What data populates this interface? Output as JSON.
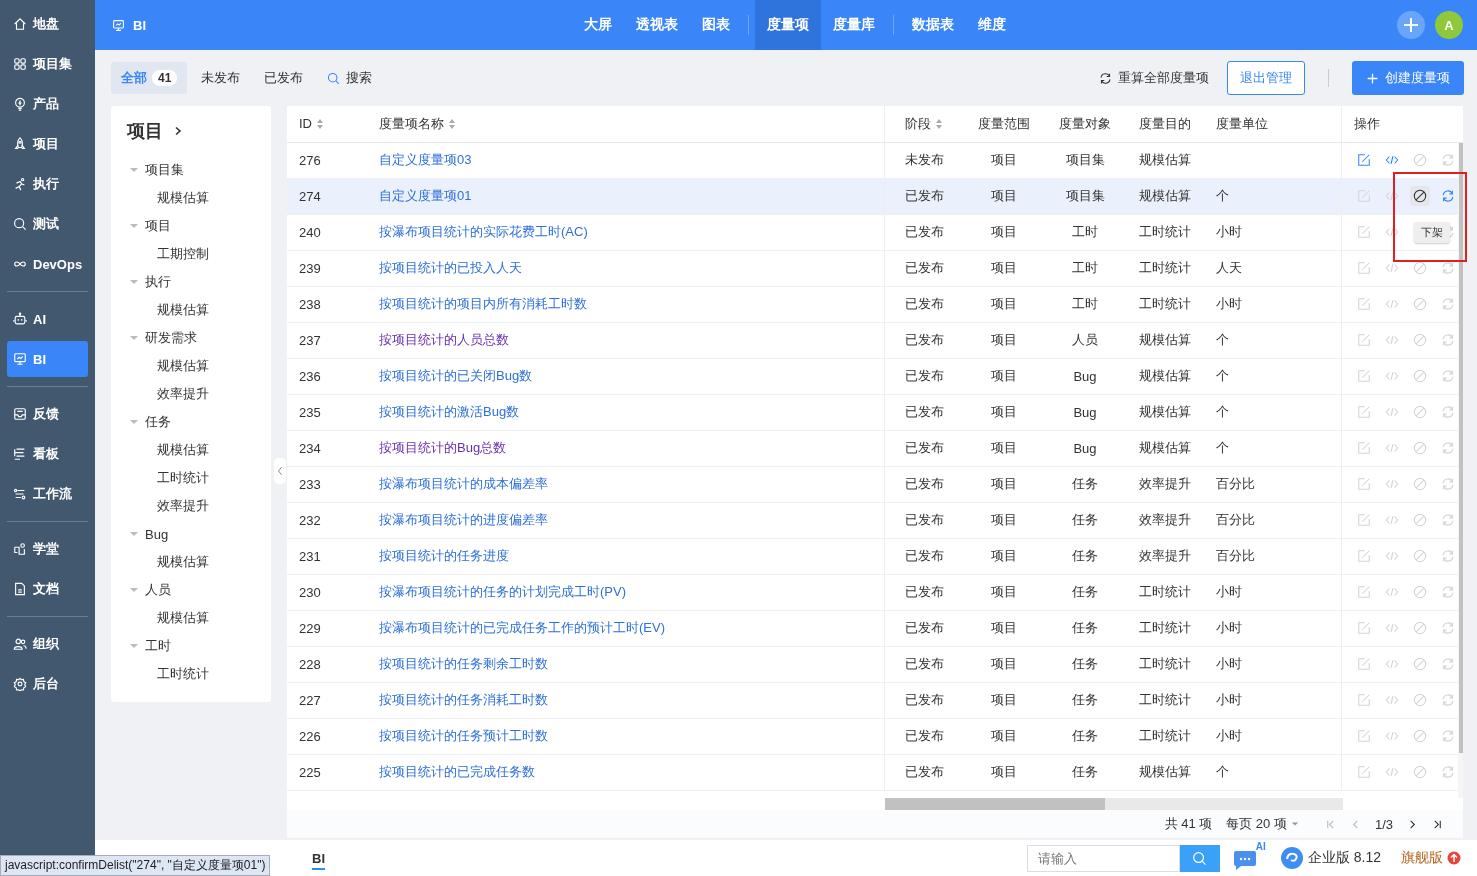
{
  "sidebar": {
    "groups": [
      [
        {
          "label": "地盘",
          "selected": false
        },
        {
          "label": "项目集",
          "selected": false
        },
        {
          "label": "产品",
          "selected": false
        },
        {
          "label": "项目",
          "selected": false
        },
        {
          "label": "执行",
          "selected": false
        },
        {
          "label": "测试",
          "selected": false
        },
        {
          "label": "DevOps",
          "selected": false
        }
      ],
      [
        {
          "label": "AI",
          "selected": false
        },
        {
          "label": "BI",
          "selected": true
        }
      ],
      [
        {
          "label": "反馈",
          "selected": false
        },
        {
          "label": "看板",
          "selected": false
        },
        {
          "label": "工作流",
          "selected": false
        }
      ],
      [
        {
          "label": "学堂",
          "selected": false
        },
        {
          "label": "文档",
          "selected": false
        }
      ],
      [
        {
          "label": "组织",
          "selected": false
        },
        {
          "label": "后台",
          "selected": false
        }
      ]
    ]
  },
  "header": {
    "module": "BI",
    "nav_groups": [
      [
        {
          "label": "大屏",
          "selected": false
        },
        {
          "label": "透视表",
          "selected": false
        },
        {
          "label": "图表",
          "selected": false
        }
      ],
      [
        {
          "label": "度量项",
          "selected": true
        },
        {
          "label": "度量库",
          "selected": false
        }
      ],
      [
        {
          "label": "数据表",
          "selected": false
        },
        {
          "label": "维度",
          "selected": false
        }
      ]
    ],
    "avatar": "A"
  },
  "filter_tabs": [
    {
      "label": "全部",
      "count": "41",
      "selected": true
    },
    {
      "label": "未发布",
      "selected": false
    },
    {
      "label": "已发布",
      "selected": false
    }
  ],
  "search_label": "搜索",
  "recalc_label": "重算全部度量项",
  "exit_button": "退出管理",
  "create_button": "创建度量项",
  "tree": {
    "title": "项目",
    "items": [
      {
        "label": "项目集",
        "expanded": true,
        "children": [
          {
            "label": "规模估算"
          }
        ]
      },
      {
        "label": "项目",
        "expanded": true,
        "children": [
          {
            "label": "工期控制"
          }
        ]
      },
      {
        "label": "执行",
        "expanded": true,
        "children": [
          {
            "label": "规模估算"
          }
        ]
      },
      {
        "label": "研发需求",
        "expanded": true,
        "children": [
          {
            "label": "规模估算"
          },
          {
            "label": "效率提升"
          }
        ]
      },
      {
        "label": "任务",
        "expanded": true,
        "children": [
          {
            "label": "规模估算"
          },
          {
            "label": "工时统计"
          },
          {
            "label": "效率提升"
          }
        ]
      },
      {
        "label": "Bug",
        "expanded": true,
        "children": [
          {
            "label": "规模估算"
          }
        ]
      },
      {
        "label": "人员",
        "expanded": true,
        "children": [
          {
            "label": "规模估算"
          }
        ]
      },
      {
        "label": "工时",
        "expanded": true,
        "children": [
          {
            "label": "工时统计"
          }
        ]
      }
    ]
  },
  "table": {
    "columns": [
      {
        "label": "ID",
        "sortable": true
      },
      {
        "label": "度量项名称",
        "sortable": true
      },
      {
        "label": "阶段",
        "sortable": true
      },
      {
        "label": "度量范围",
        "sortable": false
      },
      {
        "label": "度量对象",
        "sortable": false
      },
      {
        "label": "度量目的",
        "sortable": false
      },
      {
        "label": "度量单位",
        "sortable": false
      },
      {
        "label": "操作",
        "sortable": false
      }
    ],
    "rows": [
      {
        "id": "276",
        "name": "自定义度量项03",
        "visited": false,
        "stage": "未发布",
        "scope": "项目",
        "object": "项目集",
        "purpose": "规模估算",
        "hovered": false,
        "actions": [
          {
            "enabled": true,
            "hovered": false
          },
          {
            "enabled": true,
            "hovered": false
          },
          {
            "enabled": false,
            "hovered": false
          },
          {
            "enabled": false,
            "hovered": false
          }
        ]
      },
      {
        "id": "274",
        "name": "自定义度量项01",
        "visited": false,
        "stage": "已发布",
        "scope": "项目",
        "object": "项目集",
        "purpose": "规模估算",
        "unit": "个",
        "hovered": true,
        "actions": [
          {
            "enabled": false,
            "hovered": false
          },
          {
            "enabled": false,
            "hovered": false
          },
          {
            "enabled": true,
            "hovered": true
          },
          {
            "enabled": true,
            "hovered": false
          }
        ]
      },
      {
        "id": "240",
        "name": "按瀑布项目统计的实际花费工时(AC)",
        "visited": false,
        "stage": "已发布",
        "scope": "项目",
        "object": "工时",
        "purpose": "工时统计",
        "unit": "小时",
        "hovered": false,
        "actions": [
          {
            "enabled": false,
            "hovered": false
          },
          {
            "enabled": false,
            "hovered": false
          },
          {
            "enabled": false,
            "hovered": false
          },
          {
            "enabled": false,
            "hovered": false
          }
        ]
      },
      {
        "id": "239",
        "name": "按项目统计的已投入人天",
        "visited": false,
        "stage": "已发布",
        "scope": "项目",
        "object": "工时",
        "purpose": "工时统计",
        "unit": "人天",
        "hovered": false,
        "actions": [
          {
            "enabled": false,
            "hovered": false
          },
          {
            "enabled": false,
            "hovered": false
          },
          {
            "enabled": false,
            "hovered": false
          },
          {
            "enabled": false,
            "hovered": false
          }
        ]
      },
      {
        "id": "238",
        "name": "按项目统计的项目内所有消耗工时数",
        "visited": false,
        "stage": "已发布",
        "scope": "项目",
        "object": "工时",
        "purpose": "工时统计",
        "unit": "小时",
        "hovered": false,
        "actions": [
          {
            "enabled": false,
            "hovered": false
          },
          {
            "enabled": false,
            "hovered": false
          },
          {
            "enabled": false,
            "hovered": false
          },
          {
            "enabled": false,
            "hovered": false
          }
        ]
      },
      {
        "id": "237",
        "name": "按项目统计的人员总数",
        "visited": true,
        "stage": "已发布",
        "scope": "项目",
        "object": "人员",
        "purpose": "规模估算",
        "unit": "个",
        "hovered": false,
        "actions": [
          {
            "enabled": false,
            "hovered": false
          },
          {
            "enabled": false,
            "hovered": false
          },
          {
            "enabled": false,
            "hovered": false
          },
          {
            "enabled": false,
            "hovered": false
          }
        ]
      },
      {
        "id": "236",
        "name": "按项目统计的已关闭Bug数",
        "visited": false,
        "stage": "已发布",
        "scope": "项目",
        "object": "Bug",
        "purpose": "规模估算",
        "unit": "个",
        "hovered": false,
        "actions": [
          {
            "enabled": false,
            "hovered": false
          },
          {
            "enabled": false,
            "hovered": false
          },
          {
            "enabled": false,
            "hovered": false
          },
          {
            "enabled": false,
            "hovered": false
          }
        ]
      },
      {
        "id": "235",
        "name": "按项目统计的激活Bug数",
        "visited": false,
        "stage": "已发布",
        "scope": "项目",
        "object": "Bug",
        "purpose": "规模估算",
        "unit": "个",
        "hovered": false,
        "actions": [
          {
            "enabled": false,
            "hovered": false
          },
          {
            "enabled": false,
            "hovered": false
          },
          {
            "enabled": false,
            "hovered": false
          },
          {
            "enabled": false,
            "hovered": false
          }
        ]
      },
      {
        "id": "234",
        "name": "按项目统计的Bug总数",
        "visited": true,
        "stage": "已发布",
        "scope": "项目",
        "object": "Bug",
        "purpose": "规模估算",
        "unit": "个",
        "hovered": false,
        "actions": [
          {
            "enabled": false,
            "hovered": false
          },
          {
            "enabled": false,
            "hovered": false
          },
          {
            "enabled": false,
            "hovered": false
          },
          {
            "enabled": false,
            "hovered": false
          }
        ]
      },
      {
        "id": "233",
        "name": "按瀑布项目统计的成本偏差率",
        "visited": false,
        "stage": "已发布",
        "scope": "项目",
        "object": "任务",
        "purpose": "效率提升",
        "unit": "百分比",
        "hovered": false,
        "actions": [
          {
            "enabled": false,
            "hovered": false
          },
          {
            "enabled": false,
            "hovered": false
          },
          {
            "enabled": false,
            "hovered": false
          },
          {
            "enabled": false,
            "hovered": false
          }
        ]
      },
      {
        "id": "232",
        "name": "按瀑布项目统计的进度偏差率",
        "visited": false,
        "stage": "已发布",
        "scope": "项目",
        "object": "任务",
        "purpose": "效率提升",
        "unit": "百分比",
        "hovered": false,
        "actions": [
          {
            "enabled": false,
            "hovered": false
          },
          {
            "enabled": false,
            "hovered": false
          },
          {
            "enabled": false,
            "hovered": false
          },
          {
            "enabled": false,
            "hovered": false
          }
        ]
      },
      {
        "id": "231",
        "name": "按项目统计的任务进度",
        "visited": false,
        "stage": "已发布",
        "scope": "项目",
        "object": "任务",
        "purpose": "效率提升",
        "unit": "百分比",
        "hovered": false,
        "actions": [
          {
            "enabled": false,
            "hovered": false
          },
          {
            "enabled": false,
            "hovered": false
          },
          {
            "enabled": false,
            "hovered": false
          },
          {
            "enabled": false,
            "hovered": false
          }
        ]
      },
      {
        "id": "230",
        "name": "按瀑布项目统计的任务的计划完成工时(PV)",
        "visited": false,
        "stage": "已发布",
        "scope": "项目",
        "object": "任务",
        "purpose": "工时统计",
        "unit": "小时",
        "hovered": false,
        "actions": [
          {
            "enabled": false,
            "hovered": false
          },
          {
            "enabled": false,
            "hovered": false
          },
          {
            "enabled": false,
            "hovered": false
          },
          {
            "enabled": false,
            "hovered": false
          }
        ]
      },
      {
        "id": "229",
        "name": "按瀑布项目统计的已完成任务工作的预计工时(EV)",
        "visited": false,
        "stage": "已发布",
        "scope": "项目",
        "object": "任务",
        "purpose": "工时统计",
        "unit": "小时",
        "hovered": false,
        "actions": [
          {
            "enabled": false,
            "hovered": false
          },
          {
            "enabled": false,
            "hovered": false
          },
          {
            "enabled": false,
            "hovered": false
          },
          {
            "enabled": false,
            "hovered": false
          }
        ]
      },
      {
        "id": "228",
        "name": "按项目统计的任务剩余工时数",
        "visited": false,
        "stage": "已发布",
        "scope": "项目",
        "object": "任务",
        "purpose": "工时统计",
        "unit": "小时",
        "hovered": false,
        "actions": [
          {
            "enabled": false,
            "hovered": false
          },
          {
            "enabled": false,
            "hovered": false
          },
          {
            "enabled": false,
            "hovered": false
          },
          {
            "enabled": false,
            "hovered": false
          }
        ]
      },
      {
        "id": "227",
        "name": "按项目统计的任务消耗工时数",
        "visited": false,
        "stage": "已发布",
        "scope": "项目",
        "object": "任务",
        "purpose": "工时统计",
        "unit": "小时",
        "hovered": false,
        "actions": [
          {
            "enabled": false,
            "hovered": false
          },
          {
            "enabled": false,
            "hovered": false
          },
          {
            "enabled": false,
            "hovered": false
          },
          {
            "enabled": false,
            "hovered": false
          }
        ]
      },
      {
        "id": "226",
        "name": "按项目统计的任务预计工时数",
        "visited": false,
        "stage": "已发布",
        "scope": "项目",
        "object": "任务",
        "purpose": "工时统计",
        "unit": "小时",
        "hovered": false,
        "actions": [
          {
            "enabled": false,
            "hovered": false
          },
          {
            "enabled": false,
            "hovered": false
          },
          {
            "enabled": false,
            "hovered": false
          },
          {
            "enabled": false,
            "hovered": false
          }
        ]
      },
      {
        "id": "225",
        "name": "按项目统计的已完成任务数",
        "visited": false,
        "stage": "已发布",
        "scope": "项目",
        "object": "任务",
        "purpose": "规模估算",
        "unit": "个",
        "hovered": false,
        "actions": [
          {
            "enabled": false,
            "hovered": false
          },
          {
            "enabled": false,
            "hovered": false
          },
          {
            "enabled": false,
            "hovered": false
          },
          {
            "enabled": false,
            "hovered": false
          }
        ]
      }
    ]
  },
  "tooltip": "下架",
  "pagination": {
    "total": "共 41 项",
    "page_size": "每页 20 项",
    "page": "1/3"
  },
  "footer": {
    "tab": "BI",
    "search_placeholder": "请输入",
    "ai_badge": "AI",
    "edition": "企业版 8.12",
    "upgrade": "旗舰版"
  },
  "status_url": "javascript:confirmDelist(\"274\", \"自定义度量项01\")"
}
